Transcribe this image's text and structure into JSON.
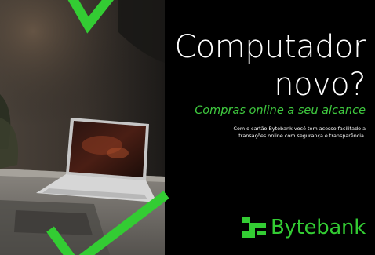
{
  "headline": {
    "line1": "Computador",
    "line2": "novo?"
  },
  "tagline": "Compras online a seu alcance",
  "body": {
    "line1": "Com o cartão Bytebank você tem acesso facilitado a",
    "line2": "transações online com segurança e transparência."
  },
  "brand": {
    "name": "Bytebank",
    "logo_icon": "bytebank-logo-icon"
  },
  "colors": {
    "background": "#000000",
    "accent_green": "#33cc33",
    "text_white": "#ffffff"
  }
}
